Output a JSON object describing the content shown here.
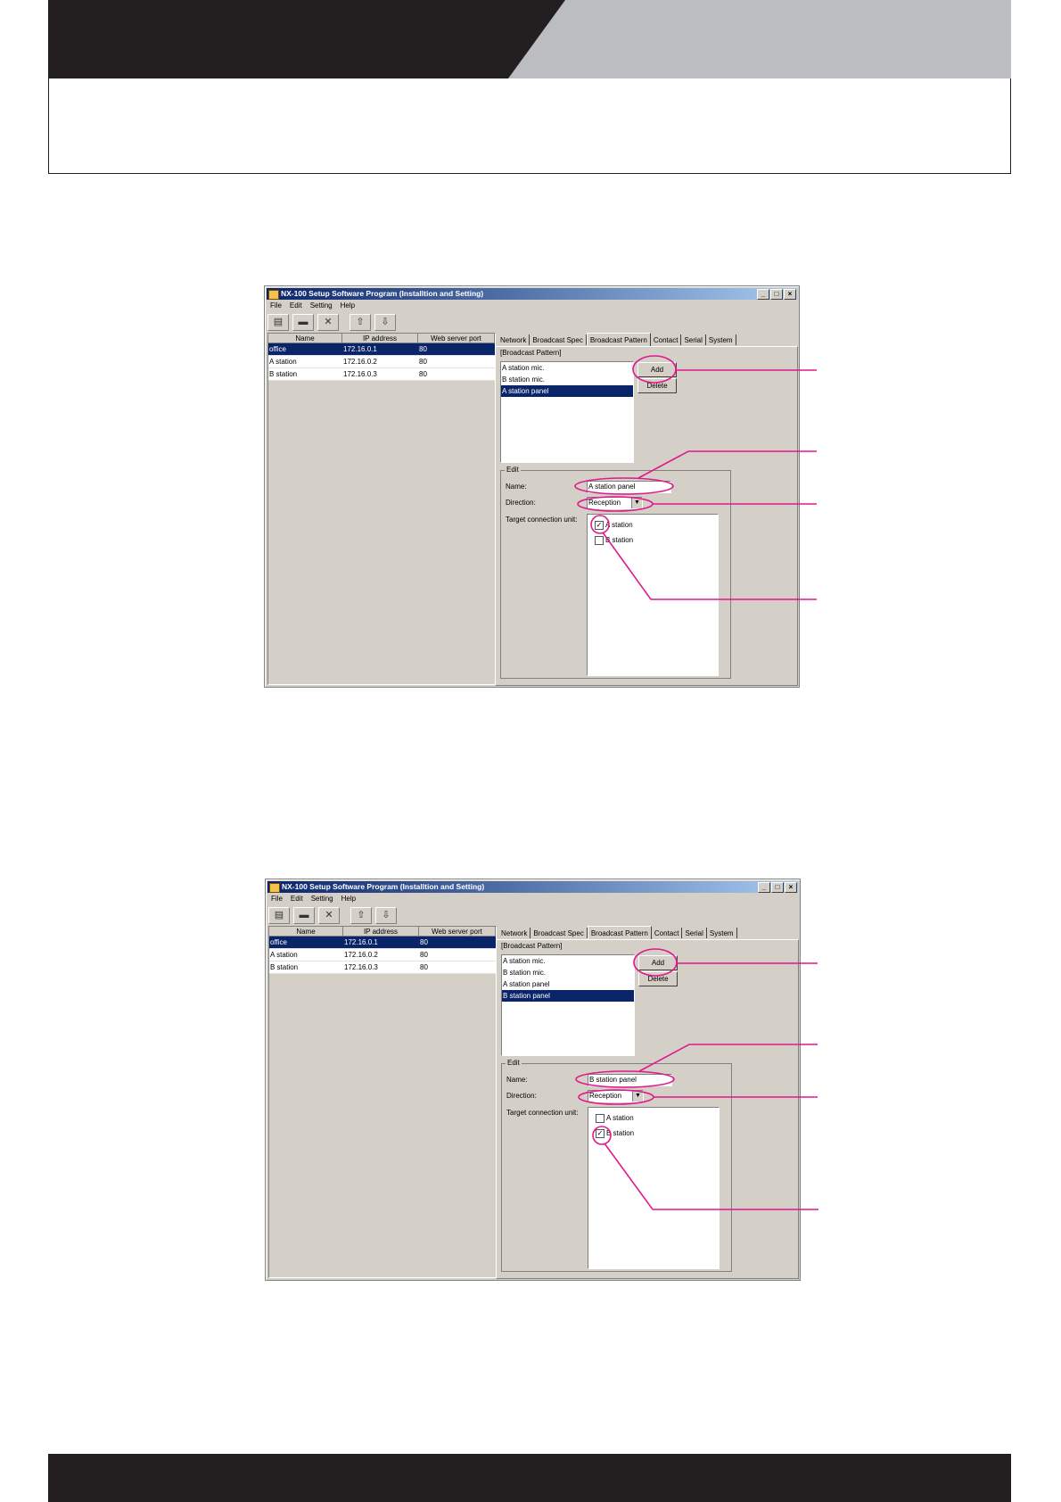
{
  "windows": [
    {
      "title": "NX-100 Setup Software Program (Installtion and Setting)",
      "titlebar_buttons": [
        "_",
        "□",
        "×"
      ],
      "menu": [
        "File",
        "Edit",
        "Setting",
        "Help"
      ],
      "toolbar_icons": [
        "save-icon",
        "network-icon",
        "disconnect-icon",
        "upload-icon",
        "download-icon"
      ],
      "grid": {
        "headers": [
          "Name",
          "IP address",
          "Web server port"
        ],
        "rows": [
          {
            "name": "office",
            "ip": "172.16.0.1",
            "port": "80"
          },
          {
            "name": "A station",
            "ip": "172.16.0.2",
            "port": "80"
          },
          {
            "name": "B station",
            "ip": "172.16.0.3",
            "port": "80"
          }
        ]
      },
      "tabs": [
        "Network",
        "Broadcast Spec",
        "Broadcast Pattern",
        "Contact",
        "Serial",
        "System"
      ],
      "active_tab": "Broadcast Pattern",
      "section_label": "[Broadcast Pattern]",
      "patterns": [
        "A station mic.",
        "B station mic.",
        "A station panel"
      ],
      "add_label": "Add",
      "delete_label": "Delete",
      "edit_label": "Edit",
      "name_label": "Name:",
      "name_value": "A station panel",
      "direction_label": "Direction:",
      "direction_value": "Reception",
      "target_label": "Target connection unit:",
      "units": [
        {
          "label": "A station",
          "checked": true
        },
        {
          "label": "B station",
          "checked": false
        }
      ]
    },
    {
      "title": "NX-100 Setup Software Program (Installtion and Setting)",
      "titlebar_buttons": [
        "_",
        "□",
        "×"
      ],
      "menu": [
        "File",
        "Edit",
        "Setting",
        "Help"
      ],
      "toolbar_icons": [
        "save-icon",
        "network-icon",
        "disconnect-icon",
        "upload-icon",
        "download-icon"
      ],
      "grid": {
        "headers": [
          "Name",
          "IP address",
          "Web server port"
        ],
        "rows": [
          {
            "name": "office",
            "ip": "172.16.0.1",
            "port": "80"
          },
          {
            "name": "A station",
            "ip": "172.16.0.2",
            "port": "80"
          },
          {
            "name": "B station",
            "ip": "172.16.0.3",
            "port": "80"
          }
        ]
      },
      "tabs": [
        "Network",
        "Broadcast Spec",
        "Broadcast Pattern",
        "Contact",
        "Serial",
        "System"
      ],
      "active_tab": "Broadcast Pattern",
      "section_label": "[Broadcast Pattern]",
      "patterns": [
        "A station mic.",
        "B station mic.",
        "A station panel",
        "B station panel"
      ],
      "add_label": "Add",
      "delete_label": "Delete",
      "edit_label": "Edit",
      "name_label": "Name:",
      "name_value": "B station panel",
      "direction_label": "Direction:",
      "direction_value": "Reception",
      "target_label": "Target connection unit:",
      "units": [
        {
          "label": "A station",
          "checked": false
        },
        {
          "label": "B station",
          "checked": true
        }
      ]
    }
  ],
  "colors": {
    "header_dark": "#231f20",
    "header_grey": "#bcbdc0",
    "annotation": "#e0198c",
    "selection": "#0a246a"
  }
}
